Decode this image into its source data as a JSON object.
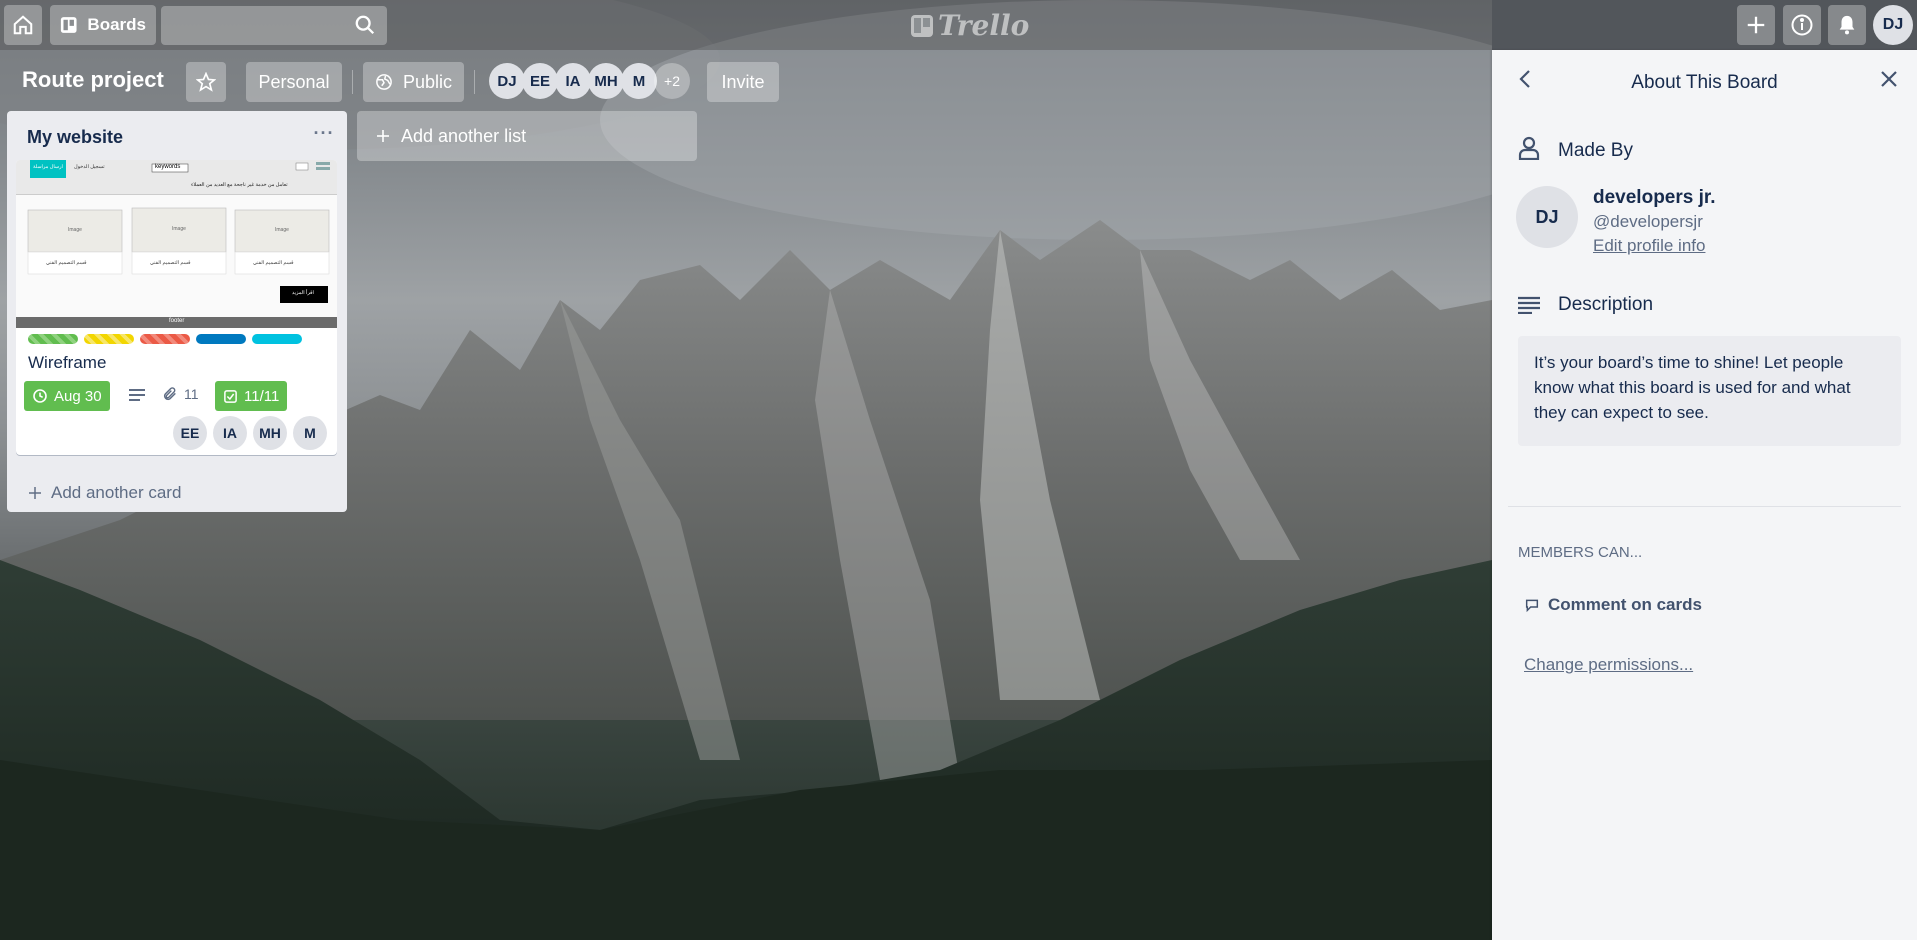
{
  "header": {
    "boards_label": "Boards",
    "search_value": "",
    "logo_text": "Trello",
    "user_initials": "DJ"
  },
  "board": {
    "title": "Route project",
    "personal_label": "Personal",
    "public_label": "Public",
    "invite_label": "Invite",
    "members": [
      "DJ",
      "EE",
      "IA",
      "MH",
      "M"
    ],
    "more_members": "+2"
  },
  "list": {
    "title": "My website",
    "menu_glyph": "···",
    "card": {
      "title": "Wireframe",
      "due": "Aug 30",
      "attachments": "11",
      "checklist": "11/11",
      "members": [
        "EE",
        "IA",
        "MH",
        "M"
      ],
      "labels": [
        {
          "color": "#61bd4f",
          "striped": true
        },
        {
          "color": "#f2d600",
          "striped": true
        },
        {
          "color": "#eb5a46",
          "striped": true
        },
        {
          "color": "#0079bf",
          "striped": false
        },
        {
          "color": "#00c2e0",
          "striped": false
        }
      ],
      "cover": {
        "header_left": "ارسال مراسلة",
        "header_mid": "تسجيل الدخول",
        "header_search": "keywords",
        "subtitle": "تعامل من خدمة غير ناجحة مع العديد من العملاء",
        "boxes": [
          "Image",
          "Image",
          "Image"
        ],
        "captions": [
          "قسم التصميم الفني",
          "قسم التصميم الفني",
          "قسم التصميم الفني"
        ],
        "cta": "اقرأ المزيد",
        "footer": "footer"
      }
    },
    "add_card_label": "Add another card"
  },
  "add_list_label": "Add another list",
  "panel": {
    "title": "About This Board",
    "made_by_label": "Made By",
    "creator_initials": "DJ",
    "creator_name": "developers jr.",
    "creator_handle": "@developersjr",
    "edit_profile_label": "Edit profile info",
    "description_label": "Description",
    "description_text": "It’s your board’s time to shine! Let people know what this board is used for and what they can expect to see.",
    "members_can_label": "MEMBERS CAN...",
    "comment_label": "Comment on cards",
    "change_permissions_label": "Change permissions..."
  },
  "colors": {
    "accent_green": "#61bd4f",
    "text_dark": "#172b4d",
    "panel_bg": "#f4f5f7"
  }
}
